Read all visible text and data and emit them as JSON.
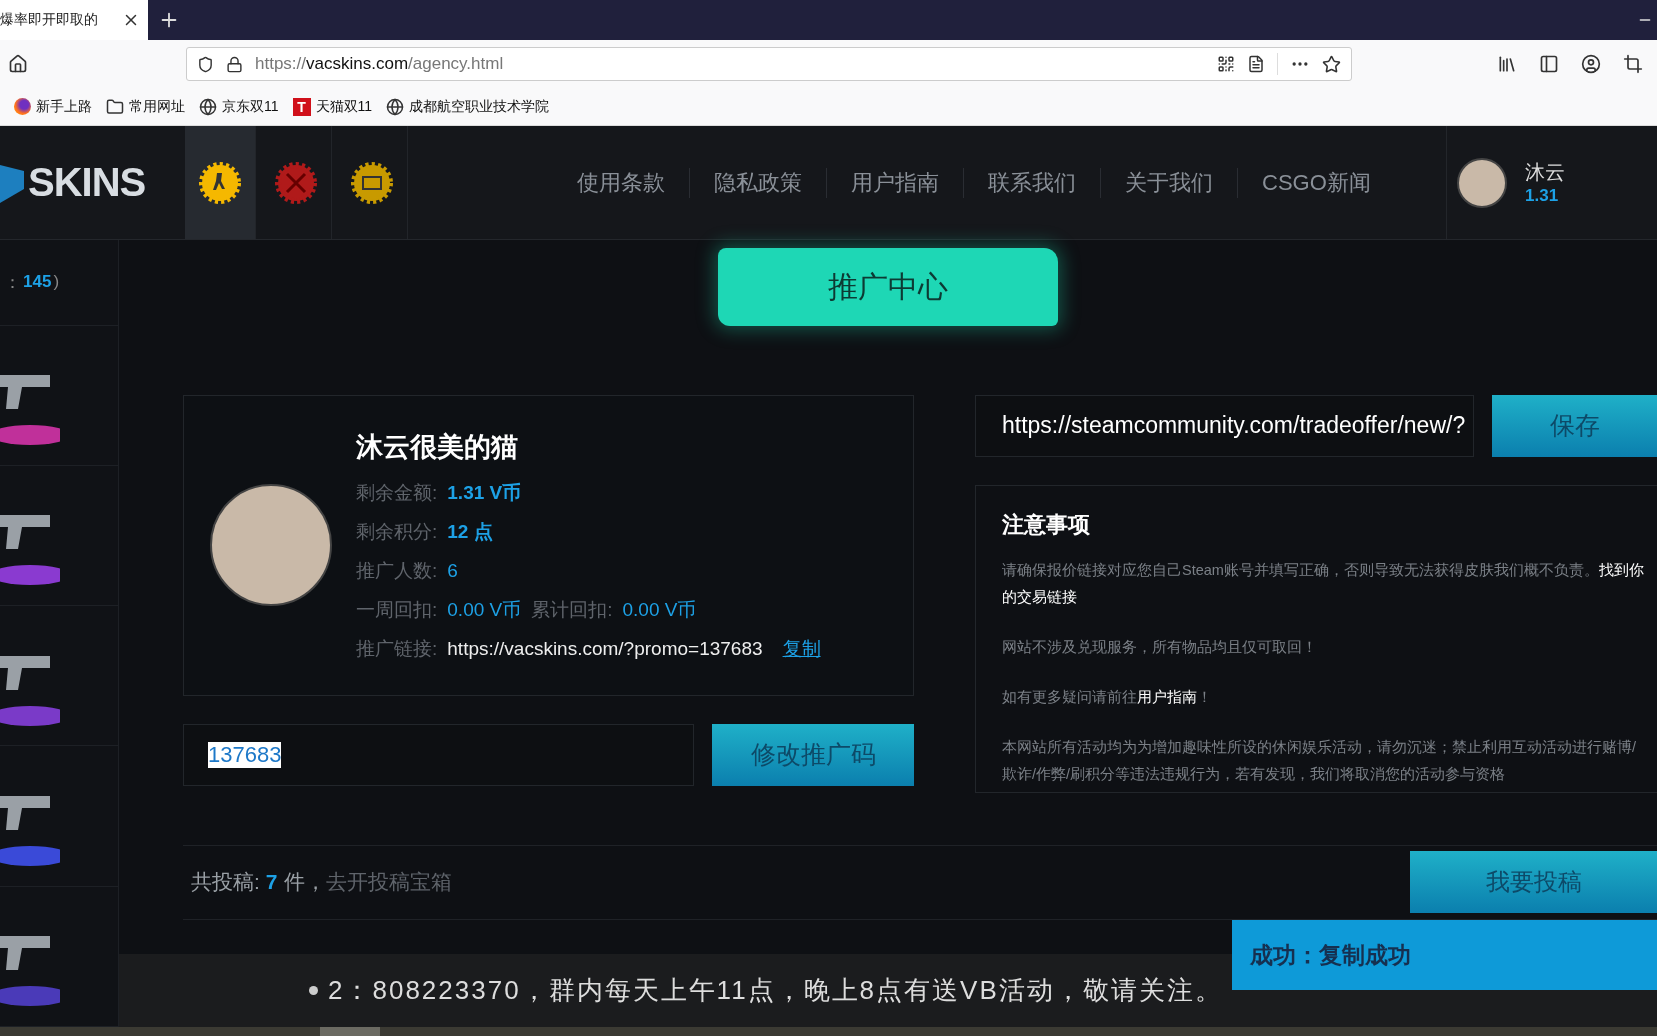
{
  "browser": {
    "tab": {
      "title": "爆率即开即取的"
    },
    "url": {
      "prefix": "https://",
      "host": "vacskins.com",
      "path": "/agency.html"
    },
    "bookmarks": [
      {
        "kind": "firefox",
        "label": "新手上路"
      },
      {
        "kind": "folder",
        "label": "常用网址"
      },
      {
        "kind": "globe",
        "label": "京东双11"
      },
      {
        "kind": "tmall",
        "label": "天猫双11",
        "icon_letter": "T"
      },
      {
        "kind": "globe",
        "label": "成都航空职业技术学院"
      }
    ]
  },
  "site": {
    "logo": "SKINS",
    "game_tabs": [
      {
        "selected": true
      },
      {
        "selected": false
      },
      {
        "selected": false
      }
    ],
    "nav": [
      "使用条款",
      "隐私政策",
      "用户指南",
      "联系我们",
      "关于我们",
      "CSGO新闻"
    ],
    "user": {
      "name": "沐云",
      "balance": "1.31"
    }
  },
  "sidebar": {
    "count_label": "：",
    "count": "145",
    "count_end": ")",
    "items": [
      {
        "color": "#c0309a"
      },
      {
        "color": "#8a3ad0"
      },
      {
        "color": "#7a3ac8"
      },
      {
        "color": "#3a4ad8"
      },
      {
        "color": "#4a3ab8"
      }
    ]
  },
  "banner": {
    "title": "推广中心"
  },
  "profile": {
    "name": "沐云很美的猫",
    "rows": [
      [
        {
          "label": "剩余金额:",
          "value": "1.31 V币",
          "bold": true
        }
      ],
      [
        {
          "label": "剩余积分:",
          "value": "12 点",
          "bold": true
        }
      ],
      [
        {
          "label": "推广人数:",
          "value": "6",
          "bold": false
        }
      ],
      [
        {
          "label": "一周回扣:",
          "value": "0.00 V币",
          "bold": false
        },
        {
          "label": "累计回扣:",
          "value": "0.00 V币",
          "bold": false
        }
      ]
    ],
    "link": {
      "label": "推广链接:",
      "value": "https://vacskins.com/?promo=137683",
      "action": "复制"
    }
  },
  "promo_code": {
    "value": "137683",
    "button": "修改推广码"
  },
  "trade_url": {
    "value": "https://steamcommunity.com/tradeoffer/new/?",
    "button": "保存"
  },
  "notice": {
    "title": "注意事项",
    "paragraphs": [
      "请确保报价链接对应您自己Steam账号并填写正确，否则导致无法获得皮肤我们概不负责。**找到你的交易链接**",
      "网站不涉及兑现服务，所有物品均且仅可取回！",
      "如有更多疑问请前往**用户指南**！",
      "本网站所有活动均为为增加趣味性所设的休闲娱乐活动，请勿沉迷；禁止利用互动活动进行赌博/欺诈/作弊/刷积分等违法违规行为，若有发现，我们将取消您的活动参与资格"
    ]
  },
  "submissions": {
    "label": "共投稿:",
    "count": "7",
    "unit": "件，",
    "link": "去开投稿宝箱",
    "button": "我要投稿"
  },
  "marquee": {
    "text": "2：808223370，群内每天上午11点，晚上8点有送VB活动，敬请关注。"
  },
  "toast": {
    "text": "成功：复制成功"
  }
}
